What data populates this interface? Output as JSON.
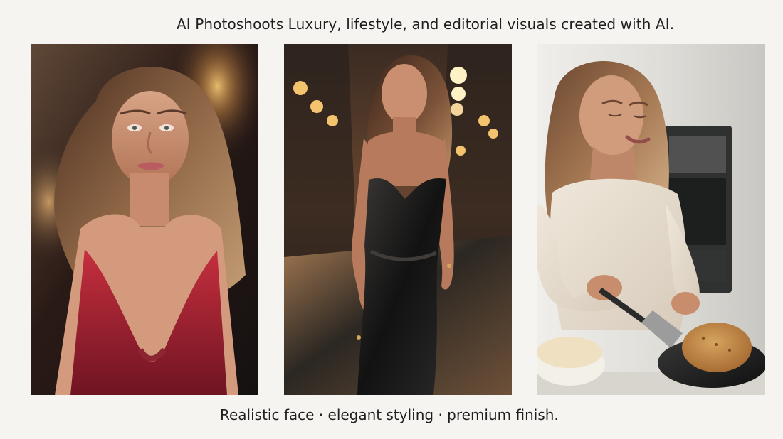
{
  "header": {
    "title": "AI Photoshoots Luxury, lifestyle, and editorial visuals created with AI."
  },
  "gallery": {
    "images": [
      {
        "name": "red-dress-portrait"
      },
      {
        "name": "black-dress-street-night"
      },
      {
        "name": "kitchen-pancake-cooking"
      }
    ]
  },
  "footer": {
    "caption": "Realistic face · elegant styling · premium finish."
  }
}
